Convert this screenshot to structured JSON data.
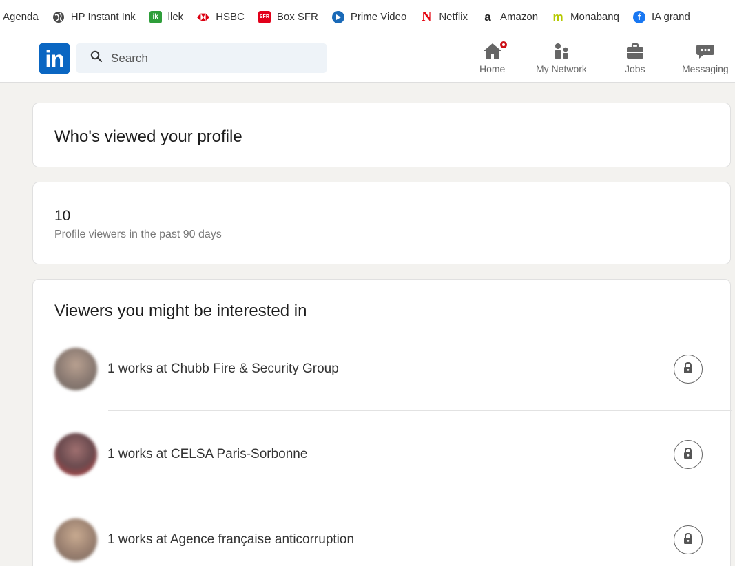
{
  "bookmarks": [
    {
      "label": "Agenda",
      "icon": "none"
    },
    {
      "label": "HP Instant Ink",
      "icon": "globe-icon"
    },
    {
      "label": "llek",
      "icon": "ilek-icon"
    },
    {
      "label": "HSBC",
      "icon": "hsbc-icon"
    },
    {
      "label": "Box SFR",
      "icon": "sfr-icon"
    },
    {
      "label": "Prime Video",
      "icon": "prime-video-icon"
    },
    {
      "label": "Netflix",
      "icon": "netflix-icon"
    },
    {
      "label": "Amazon",
      "icon": "amazon-icon"
    },
    {
      "label": "Monabanq",
      "icon": "monabanq-icon"
    },
    {
      "label": "IA grand",
      "icon": "facebook-icon"
    }
  ],
  "header": {
    "logo_text": "in",
    "search_placeholder": "Search",
    "nav": [
      {
        "label": "Home",
        "icon": "home-icon"
      },
      {
        "label": "My Network",
        "icon": "network-icon"
      },
      {
        "label": "Jobs",
        "icon": "briefcase-icon"
      },
      {
        "label": "Messaging",
        "icon": "messaging-icon"
      }
    ]
  },
  "profile_views": {
    "title": "Who's viewed your profile",
    "count": "10",
    "count_label": "Profile viewers in the past 90 days"
  },
  "viewers": {
    "title": "Viewers you might be interested in",
    "items": [
      {
        "text": "1 works at Chubb Fire & Security Group",
        "avatar_color": "#8a7a72"
      },
      {
        "text": "1 works at CELSA Paris-Sorbonne",
        "avatar_color": "#6b4b4f"
      },
      {
        "text": "1 works at Agence française anticorruption",
        "avatar_color": "#9a8070"
      }
    ]
  },
  "colors": {
    "linkedin_blue": "#0a66c2",
    "badge_red": "#cc1016",
    "search_bg": "#eef3f8",
    "page_bg": "#f3f2ef"
  }
}
